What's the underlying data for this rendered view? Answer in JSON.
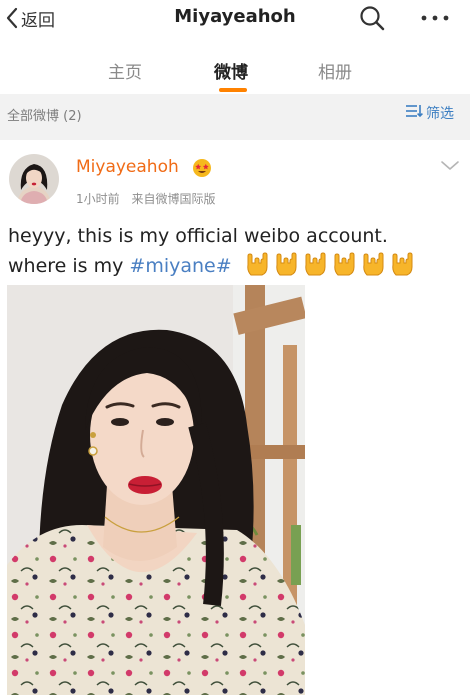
{
  "nav": {
    "back_label": "返回",
    "title": "Miyayeahoh"
  },
  "tabs": [
    {
      "label": "主页",
      "active": false
    },
    {
      "label": "微博",
      "active": true
    },
    {
      "label": "相册",
      "active": false
    }
  ],
  "filter": {
    "count_label": "全部微博 (2)",
    "filter_label": "筛选"
  },
  "post": {
    "username": "Miyayeahoh",
    "time": "1小时前",
    "source": "来自微博国际版",
    "text_line1": "heyyy, this is my official weibo account.",
    "text_line2_prefix": "where is my ",
    "hashtag": "#miyane#",
    "emoji_count": 6
  },
  "colors": {
    "accent": "#ff8200",
    "username": "#f06b16",
    "link": "#4a7fc2",
    "muted": "#8f8f8f"
  },
  "icons": [
    "chevron-left-icon",
    "search-icon",
    "more-icon",
    "filter-icon",
    "star-eyes-icon",
    "expand-chevron-icon",
    "rock-hand-icon"
  ]
}
